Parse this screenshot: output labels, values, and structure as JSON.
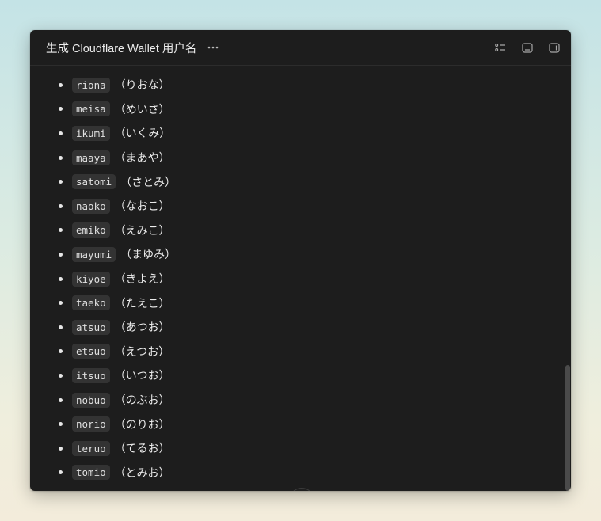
{
  "window": {
    "title": "生成 Cloudflare Wallet 用户名"
  },
  "toolbar": {
    "more_icon": "ellipsis-icon",
    "actions": [
      "list-icon",
      "terminal-panel-icon",
      "sidebar-toggle-icon"
    ]
  },
  "names": [
    {
      "code": "riona",
      "reading": "（りおな）"
    },
    {
      "code": "meisa",
      "reading": "（めいさ）"
    },
    {
      "code": "ikumi",
      "reading": "（いくみ）"
    },
    {
      "code": "maaya",
      "reading": "（まあや）"
    },
    {
      "code": "satomi",
      "reading": "（さとみ）"
    },
    {
      "code": "naoko",
      "reading": "（なおこ）"
    },
    {
      "code": "emiko",
      "reading": "（えみこ）"
    },
    {
      "code": "mayumi",
      "reading": "（まゆみ）"
    },
    {
      "code": "kiyoe",
      "reading": "（きよえ）"
    },
    {
      "code": "taeko",
      "reading": "（たえこ）"
    },
    {
      "code": "atsuo",
      "reading": "（あつお）"
    },
    {
      "code": "etsuo",
      "reading": "（えつお）"
    },
    {
      "code": "itsuo",
      "reading": "（いつお）"
    },
    {
      "code": "nobuo",
      "reading": "（のぶお）"
    },
    {
      "code": "norio",
      "reading": "（のりお）"
    },
    {
      "code": "teruo",
      "reading": "（てるお）"
    },
    {
      "code": "tomio",
      "reading": "（とみお）"
    }
  ],
  "colors": {
    "window_bg": "#1d1d1d",
    "code_bg": "#333333",
    "text": "#e6e6e6"
  }
}
